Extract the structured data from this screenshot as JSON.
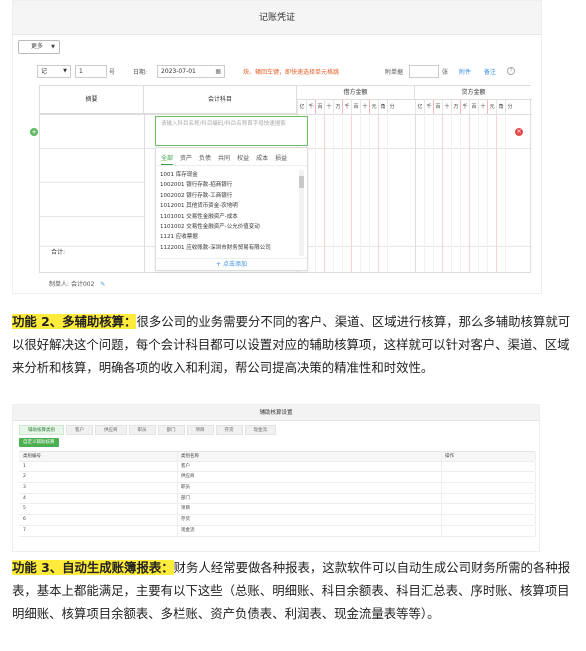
{
  "voucher": {
    "title": "记账凭证",
    "more_button": "更多",
    "word_select": "记",
    "number_value": "1",
    "number_suffix": "号",
    "date_label": "日期:",
    "date_value": "2023-07-01",
    "hint": "炔、辕回车键，即快速选择单元格跳",
    "attachments_label": "附单据",
    "attachments_unit": "张",
    "attachment_link": "附件",
    "note_link": "备注",
    "help": "?",
    "col_summary": "摘要",
    "col_account": "会计科目",
    "col_debit": "借方金额",
    "col_credit": "贷方金额",
    "digit_headers": [
      "亿",
      "千",
      "百",
      "十",
      "万",
      "千",
      "百",
      "十",
      "元",
      "角",
      "分"
    ],
    "account_placeholder": "请输入科目名称/科目编码/科目名称首字母快速搜索",
    "dropdown_tabs": [
      "全部",
      "资产",
      "负债",
      "共同",
      "权益",
      "成本",
      "损益"
    ],
    "dropdown_items": [
      "1001 库存现金",
      "1002001 银行存款-招商银行",
      "1002002 银行存款-工商银行",
      "1012001 其他货币资金-农地明",
      "1101001 交易性金融资产-成本",
      "1101002 交易性金融资产-公允价值变动",
      "1121 应收票据",
      "1122001 应收账款-深圳市财务贸易有限公司"
    ],
    "dropdown_add": "+ 点击添加",
    "total_label": "合计:",
    "maker_label": "制单人:",
    "maker_value": "会计002",
    "maker_edit": "✎"
  },
  "paragraph1": {
    "highlight": "功能 2、多辅助核算：",
    "text": "很多公司的业务需要分不同的客户、渠道、区域进行核算，那么多辅助核算就可以很好解决这个问题，每个会计科目都可以设置对应的辅助核算项，这样就可以针对客户、渠道、区域来分析和核算，明确各项的收入和利润，帮公司提高决策的精准性和时效性。"
  },
  "aux": {
    "title": "辅助核算设置",
    "tabs": [
      "辅助核算类别",
      "客户",
      "供应商",
      "职员",
      "部门",
      "项目",
      "存货",
      "现金流"
    ],
    "add_button": "自定义辅助核算",
    "headers": [
      "类别编号",
      "类别名称",
      "操作"
    ],
    "rows": [
      [
        "1",
        "客户"
      ],
      [
        "2",
        "供应商"
      ],
      [
        "3",
        "职员"
      ],
      [
        "4",
        "部门"
      ],
      [
        "5",
        "项目"
      ],
      [
        "6",
        "存货"
      ],
      [
        "7",
        "现金流"
      ]
    ]
  },
  "paragraph2": {
    "highlight": "功能 3、自动生成账簿报表：",
    "text": "财务人经常要做各种报表，这款软件可以自动生成公司财务所需的各种报表，基本上都能满足，主要有以下这些（总账、明细账、科目余额表、科目汇总表、序时账、核算项目明细账、核算项目余额表、多栏账、资产负债表、利润表、现金流量表等等）。"
  },
  "colors": {
    "highlight": "#ffeb3b",
    "accent_green": "#3aa04a",
    "link_blue": "#3a8ee6",
    "hint_orange": "#e3622b",
    "delete_red": "#e94b4b"
  }
}
